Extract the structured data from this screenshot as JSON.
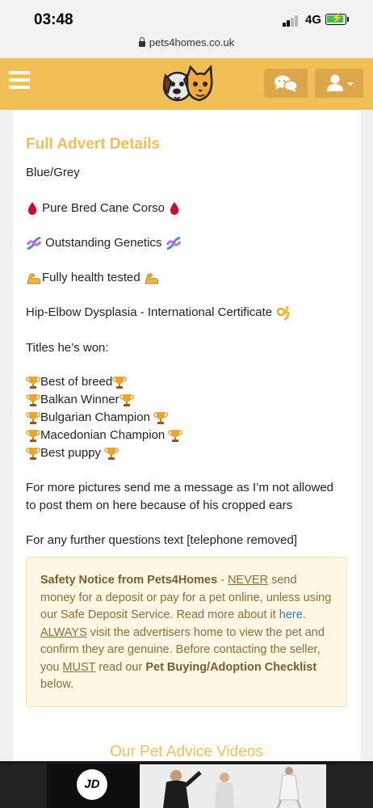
{
  "status_bar": {
    "time": "03:48",
    "network": "4G",
    "url": "pets4homes.co.uk"
  },
  "colors": {
    "brand": "#f0bf55",
    "brand_dark": "#dba74a",
    "notice_bg": "#fcf8e3",
    "notice_text": "#8a6d3b",
    "link": "#337ab7"
  },
  "header": {
    "menu_icon": "hamburger-icon",
    "logo_icon": "pets4homes-logo-icon",
    "chat_icon": "chat-bubbles-icon",
    "user_icon": "user-icon"
  },
  "advert": {
    "title": "Full Advert Details",
    "colour": "Blue/Grey",
    "breed_line": "Pure Bred Cane Corso",
    "genetics_line": "Outstanding Genetics",
    "health_line": "Fully health tested",
    "certificate_line": "Hip-Elbow Dysplasia - International Certificate",
    "titles_heading": "Titles he’s won:",
    "titles": [
      "Best of breed",
      "Balkan Winner",
      "Bulgarian Champion",
      "Macedonian Champion",
      "Best puppy"
    ],
    "pictures_line_1": "For more pictures send me a message as I’m not allowed",
    "pictures_line_2": "to post them on here because of his cropped ears",
    "contact_line": "For any further questions text [telephone removed]"
  },
  "safety_notice": {
    "heading": "Safety Notice from Pets4Homes",
    "dash": " - ",
    "never": "NEVER",
    "text_1": " send money for a deposit or pay for a pet online, unless using our Safe Deposit Service. Read more about it ",
    "here_link": "here",
    "text_2": ". ",
    "always": "ALWAYS",
    "text_3": " visit the advertisers home to view the pet and confirm they are genuine. Before contacting the seller, you ",
    "must": "MUST",
    "text_4": " read our ",
    "checklist": "Pet Buying/Adoption Checklist",
    "text_5": " below."
  },
  "videos_heading": "Our Pet Advice Videos",
  "ad": {
    "brand": "JD"
  }
}
